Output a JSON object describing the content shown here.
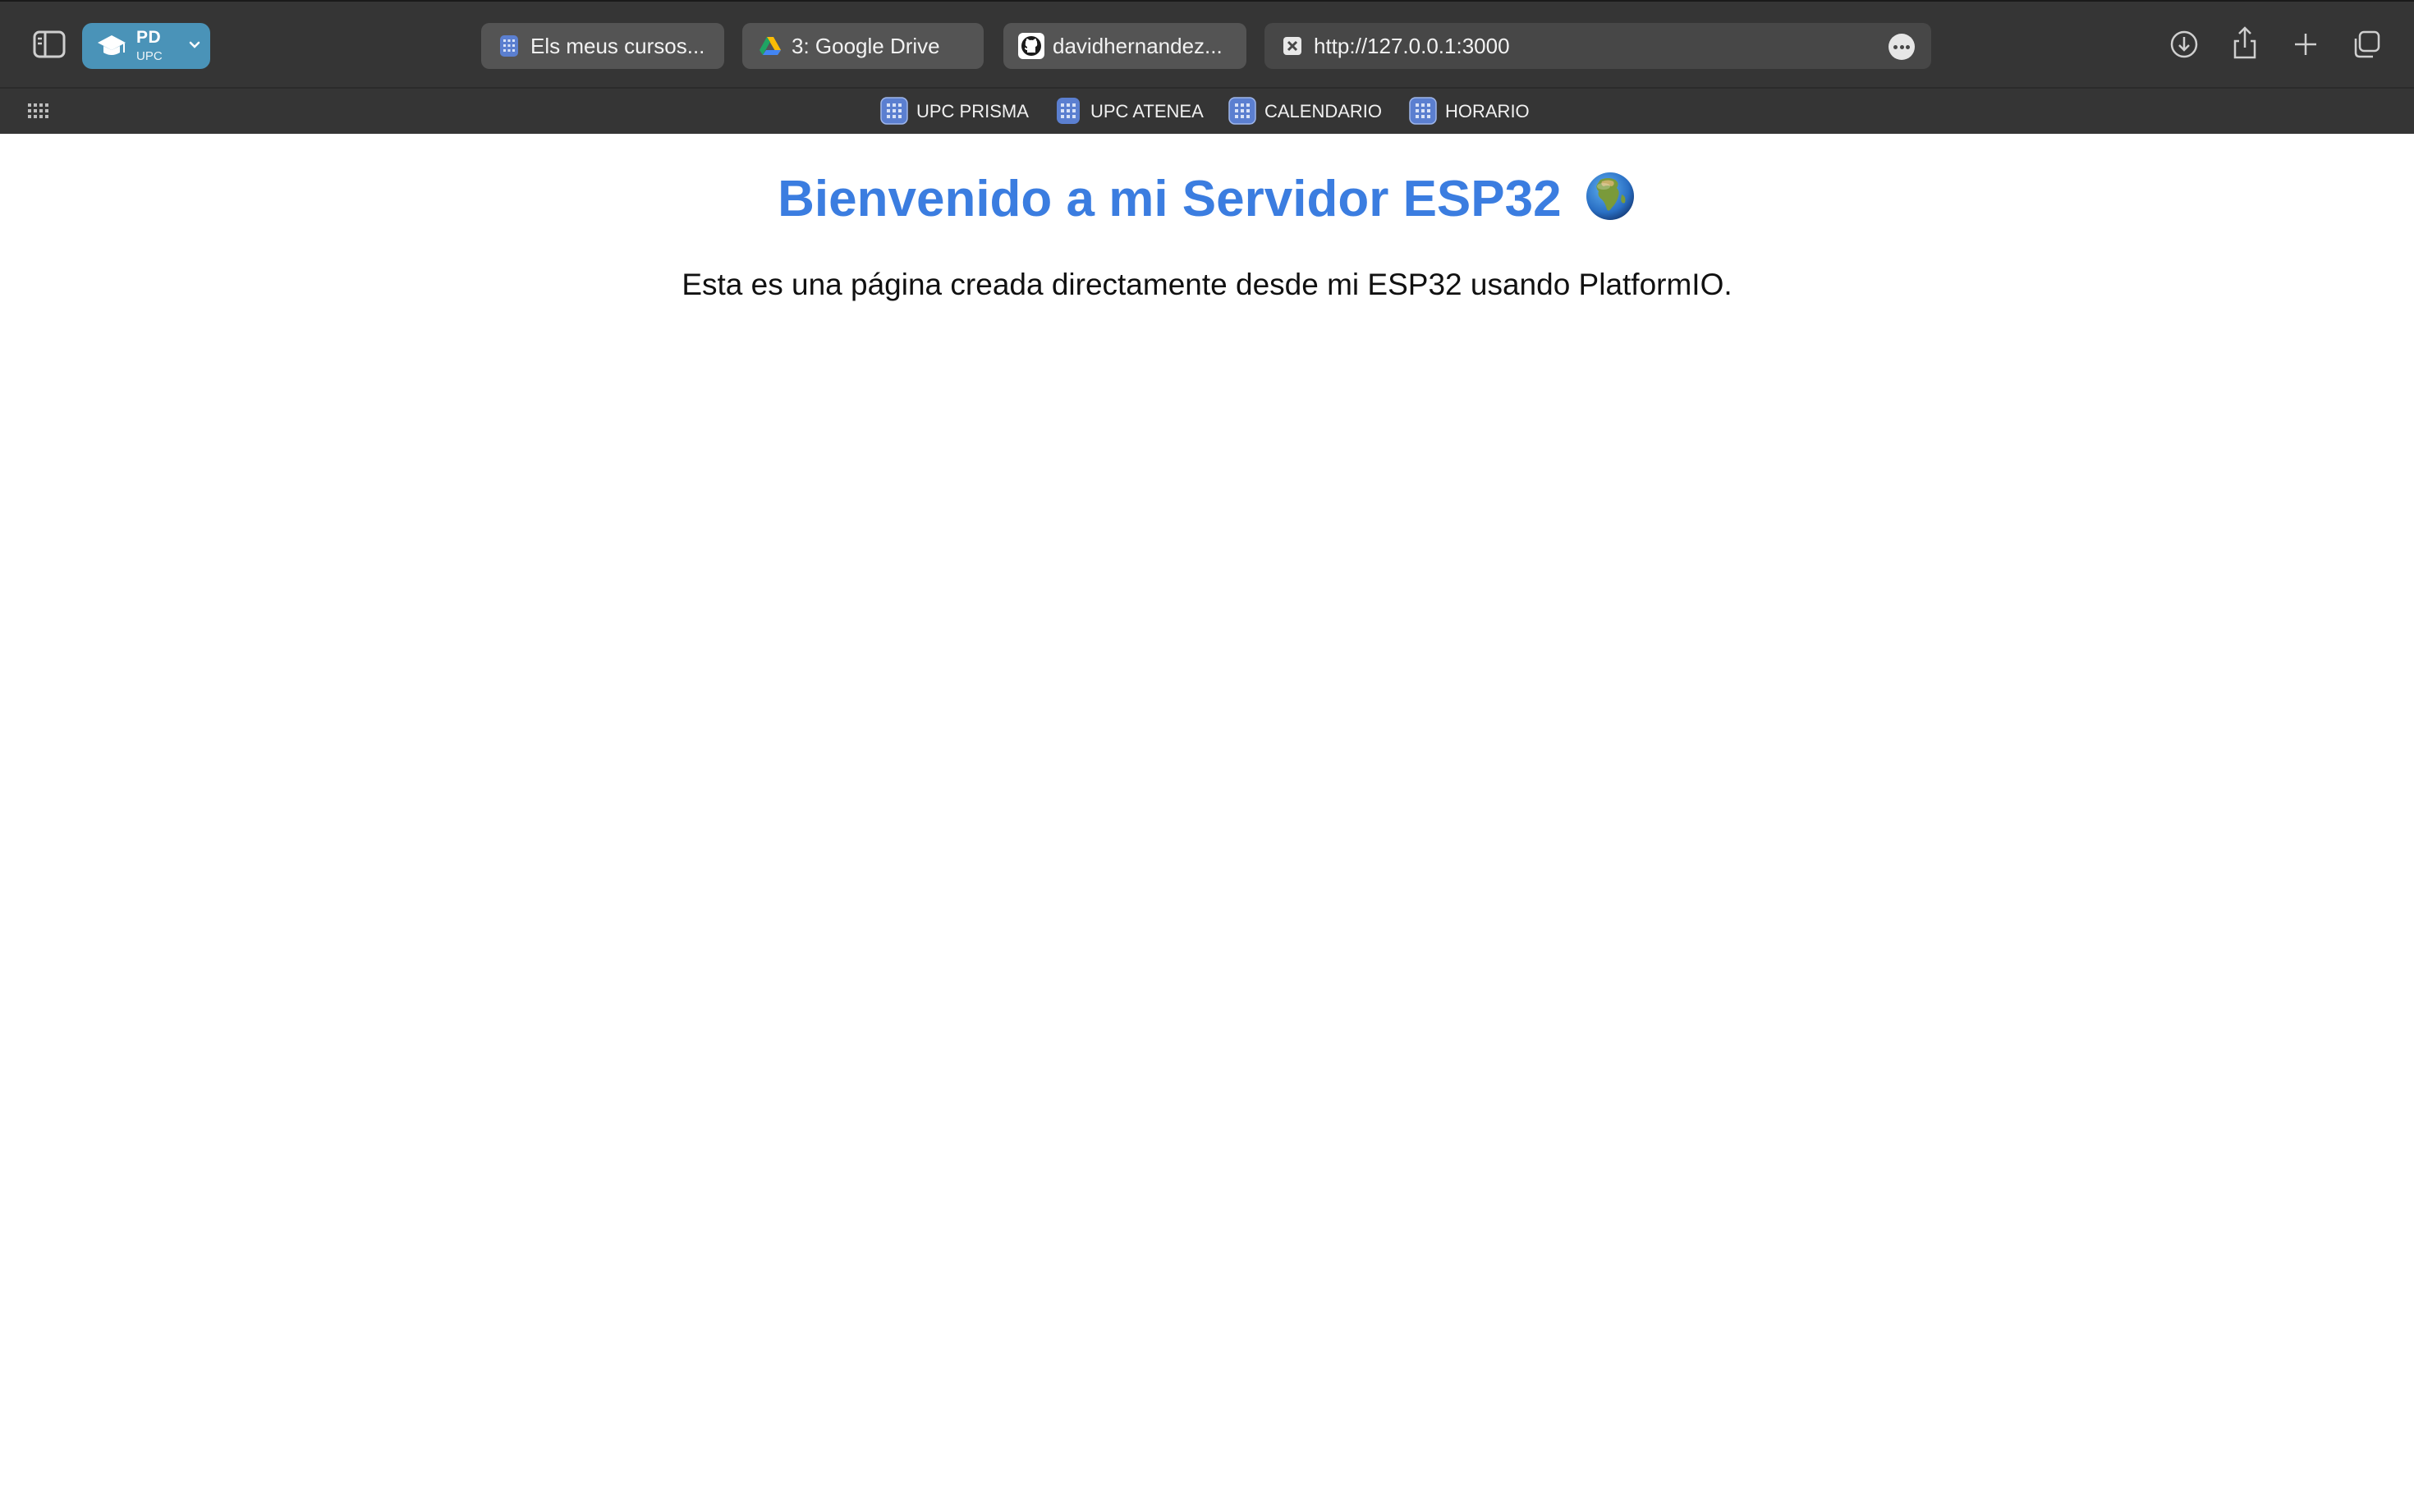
{
  "profile": {
    "name": "PD",
    "sub": "UPC"
  },
  "tabs": [
    {
      "title": "Els meus cursos...",
      "icon": "site-grid-icon"
    },
    {
      "title": "3: Google Drive",
      "icon": "google-drive-icon"
    },
    {
      "title": "davidhernandez...",
      "icon": "github-icon"
    },
    {
      "title": "http://127.0.0.1:3000",
      "icon": "close-tab-icon",
      "active": true
    }
  ],
  "bookmarks": [
    {
      "label": "UPC PRISMA",
      "icon": "site-grid-icon"
    },
    {
      "label": "UPC ATENEA",
      "icon": "site-grid-icon"
    },
    {
      "label": "CALENDARIO",
      "icon": "site-grid-icon"
    },
    {
      "label": "HORARIO",
      "icon": "site-grid-icon"
    }
  ],
  "page": {
    "title": "Bienvenido a mi Servidor ESP32",
    "title_emoji_icon": "globe-africa-icon",
    "text": "Esta es una página creada directamente desde mi ESP32 usando PlatformIO."
  },
  "colors": {
    "toolbar_bg": "#353535",
    "tab_bg": "#545454",
    "profile_bg": "#4a93b8",
    "title_color": "#3b7de0",
    "page_bg": "#ffffff"
  }
}
